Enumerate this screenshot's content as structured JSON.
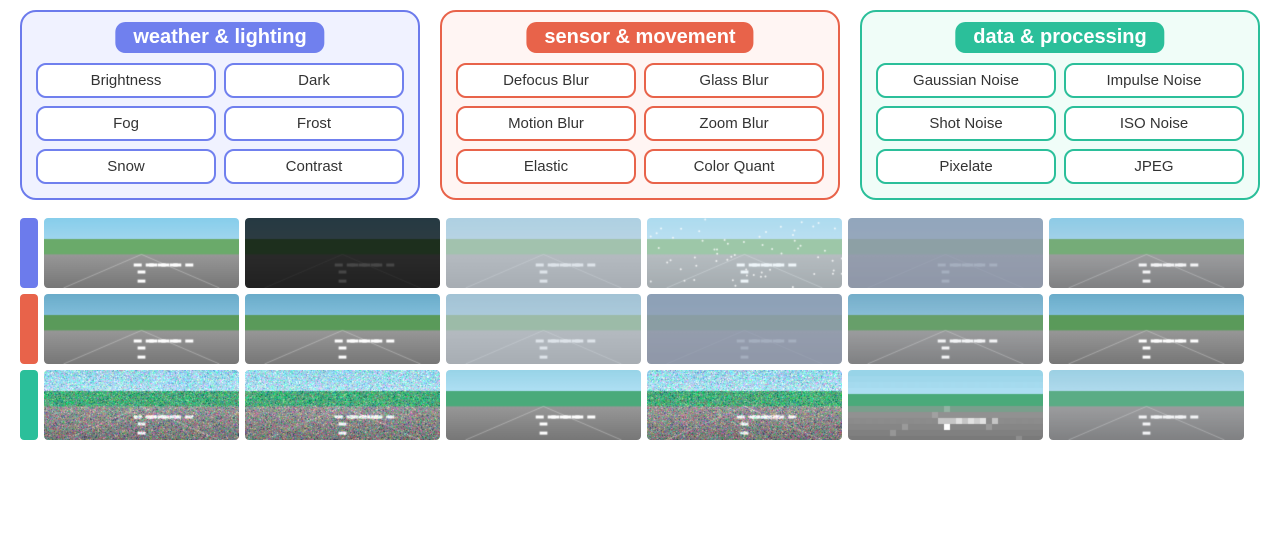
{
  "categories": [
    {
      "id": "weather",
      "title": "weather & lighting",
      "colorClass": "weather",
      "items": [
        "Brightness",
        "Dark",
        "Fog",
        "Frost",
        "Snow",
        "Contrast"
      ]
    },
    {
      "id": "sensor",
      "title": "sensor & movement",
      "colorClass": "sensor",
      "items": [
        "Defocus Blur",
        "Glass Blur",
        "Motion Blur",
        "Zoom Blur",
        "Elastic",
        "Color Quant"
      ]
    },
    {
      "id": "data",
      "title": "data & processing",
      "colorClass": "data",
      "items": [
        "Gaussian Noise",
        "Impulse Noise",
        "Shot Noise",
        "ISO Noise",
        "Pixelate",
        "JPEG"
      ]
    }
  ],
  "imageRows": [
    {
      "color": "blue",
      "label": "weather-row"
    },
    {
      "color": "red",
      "label": "sensor-row"
    },
    {
      "color": "green",
      "label": "data-row"
    }
  ],
  "imagesPerRow": 6
}
